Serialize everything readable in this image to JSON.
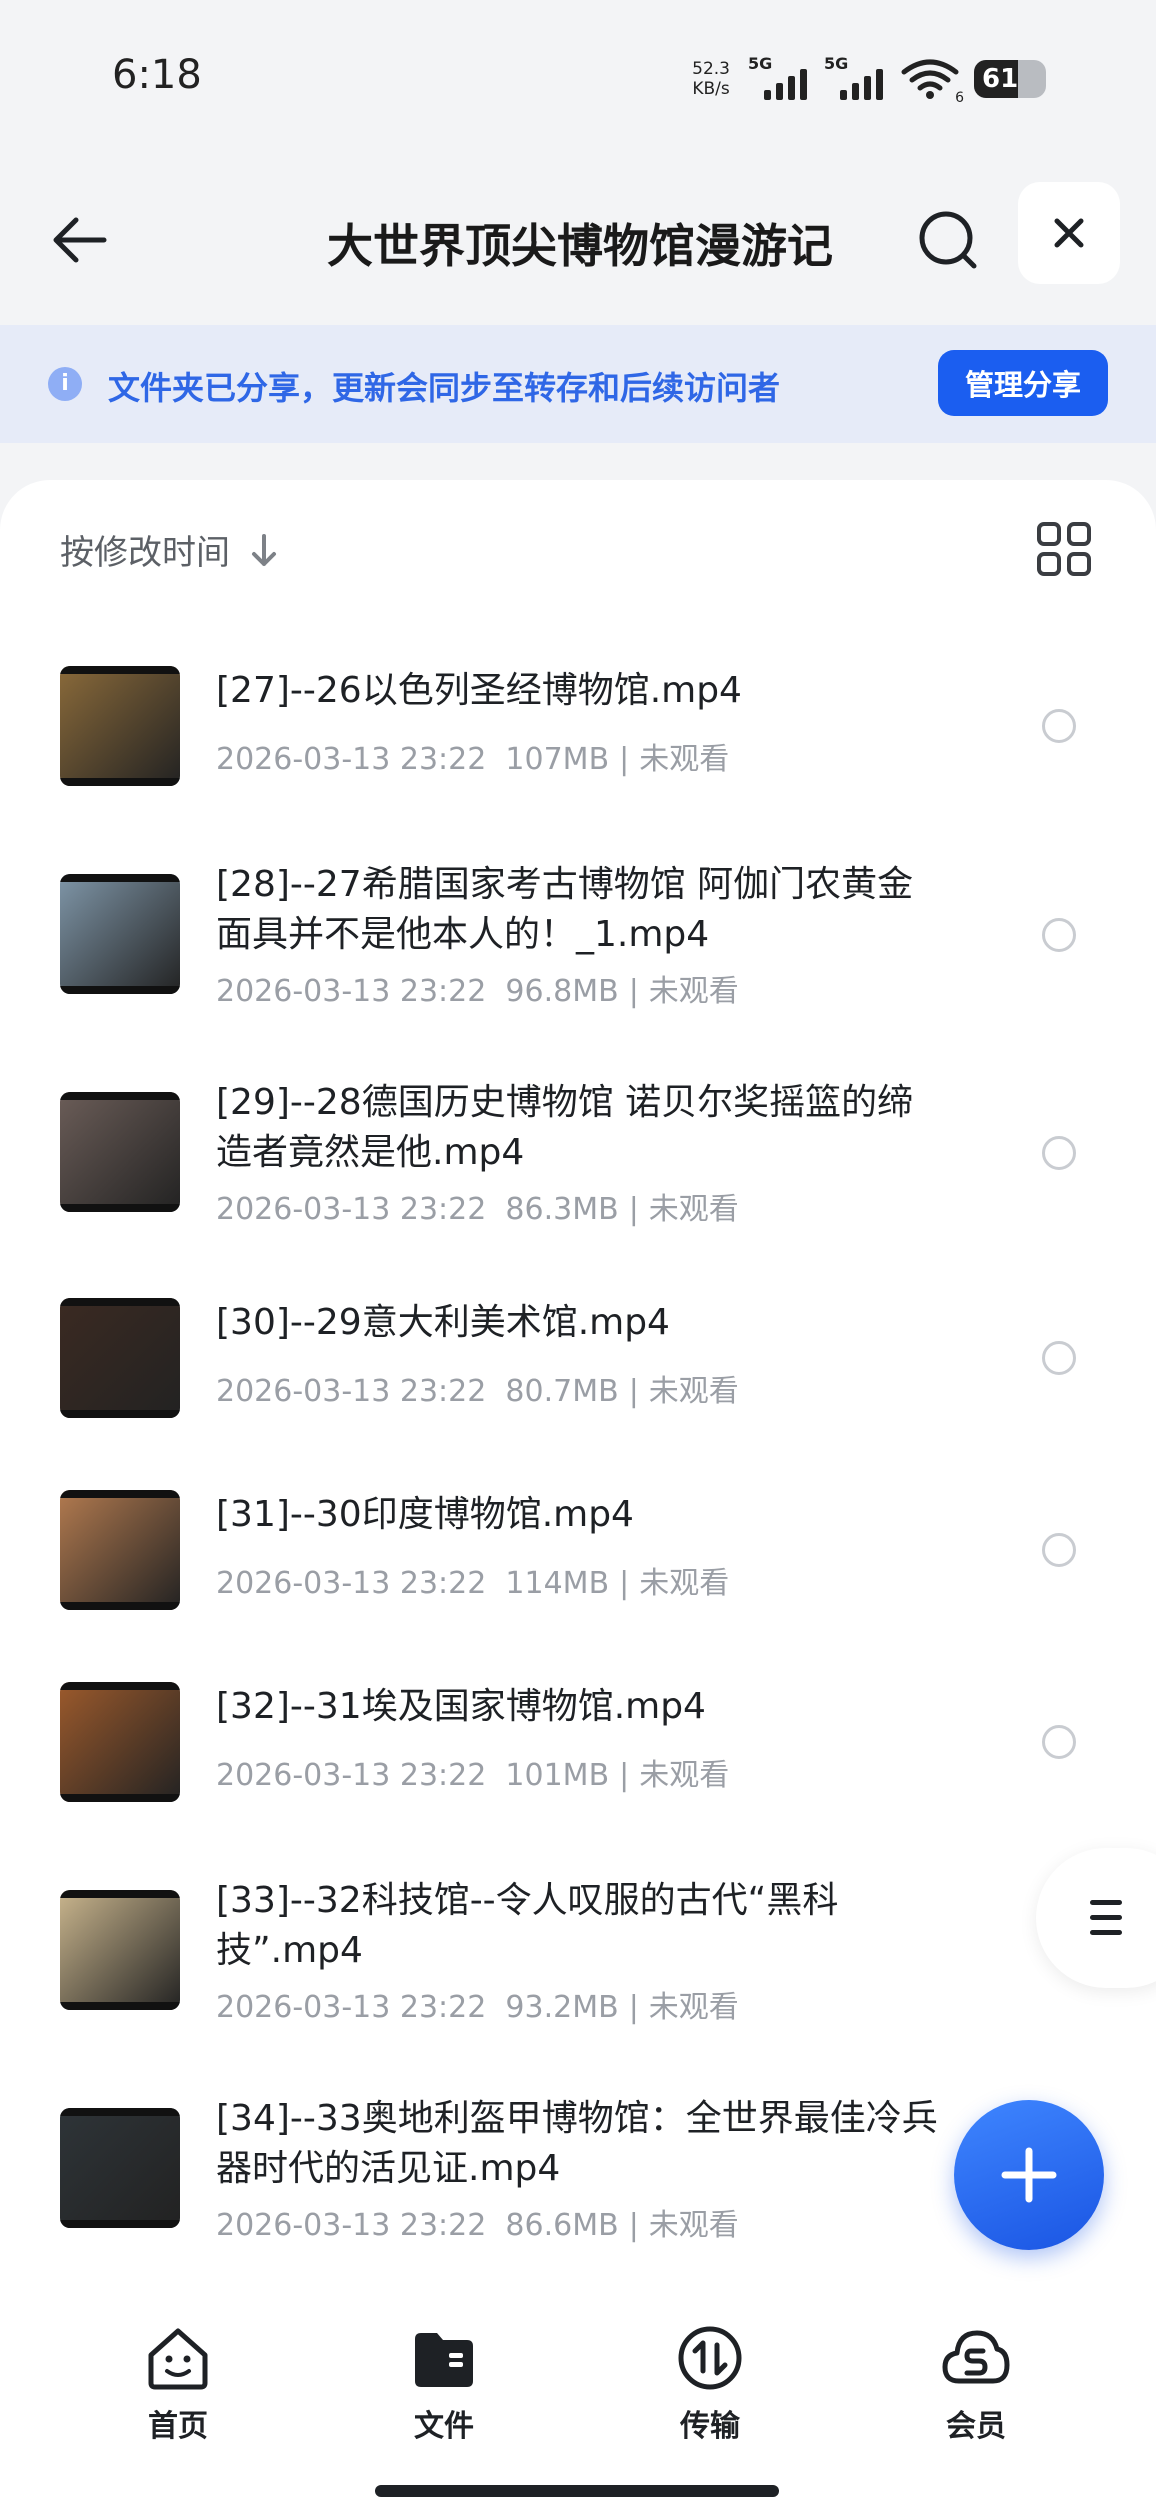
{
  "status_bar": {
    "time": "6:18",
    "net_speed_value": "52.3",
    "net_speed_unit": "KB/s",
    "sim1_tag": "5G",
    "sim2_tag": "5G",
    "wifi_badge": "6",
    "battery_percent": "61"
  },
  "header": {
    "title": "大世界顶尖博物馆漫游记",
    "back_icon": "arrow-left-icon",
    "search_icon": "search-icon",
    "close_icon": "close-icon"
  },
  "banner": {
    "info_glyph": "i",
    "text": "文件夹已分享，更新会同步至转存和后续访问者",
    "button_label": "管理分享"
  },
  "sort": {
    "label": "按修改时间",
    "direction_icon": "arrow-down-icon",
    "view_toggle_icon": "grid-view-icon"
  },
  "files": [
    {
      "name": "[27]--26以色列圣经博物馆.mp4",
      "date": "2026-03-13 23:22",
      "size": "107MB",
      "status": "未观看",
      "thumb_color": "#8a6a3a"
    },
    {
      "name": "[28]--27希腊国家考古博物馆 阿伽门农黄金面具并不是他本人的！_1.mp4",
      "date": "2026-03-13 23:22",
      "size": "96.8MB",
      "status": "未观看",
      "thumb_color": "#7f96a8"
    },
    {
      "name": "[29]--28德国历史博物馆 诺贝尔奖摇篮的缔造者竟然是他.mp4",
      "date": "2026-03-13 23:22",
      "size": "86.3MB",
      "status": "未观看",
      "thumb_color": "#6b5d58"
    },
    {
      "name": "[30]--29意大利美术馆.mp4",
      "date": "2026-03-13 23:22",
      "size": "80.7MB",
      "status": "未观看",
      "thumb_color": "#3b2a22"
    },
    {
      "name": "[31]--30印度博物馆.mp4",
      "date": "2026-03-13 23:22",
      "size": "114MB",
      "status": "未观看",
      "thumb_color": "#b27a4f"
    },
    {
      "name": "[32]--31埃及国家博物馆.mp4",
      "date": "2026-03-13 23:22",
      "size": "101MB",
      "status": "未观看",
      "thumb_color": "#9c5a2c"
    },
    {
      "name": "[33]--32科技馆--令人叹服的古代“黑科技”.mp4",
      "date": "2026-03-13 23:22",
      "size": "93.2MB",
      "status": "未观看",
      "thumb_color": "#c9b58d"
    },
    {
      "name": "[34]--33奥地利盔甲博物馆：全世界最佳冷兵器时代的活见证.mp4",
      "date": "2026-03-13 23:22",
      "size": "86.6MB",
      "status": "未观看",
      "thumb_color": "#2e3438"
    }
  ],
  "floating": {
    "menu_icon": "menu-icon",
    "add_icon": "plus-icon"
  },
  "bottom_nav": [
    {
      "label": "首页",
      "icon": "home-smile-icon"
    },
    {
      "label": "文件",
      "icon": "folder-icon"
    },
    {
      "label": "传输",
      "icon": "transfer-icon"
    },
    {
      "label": "会员",
      "icon": "cloud-vip-icon"
    }
  ],
  "colors": {
    "accent": "#1b5ef0",
    "banner_bg": "#e6ebf8",
    "banner_text": "#2f67e6",
    "meta_text": "#9a9ea5"
  }
}
